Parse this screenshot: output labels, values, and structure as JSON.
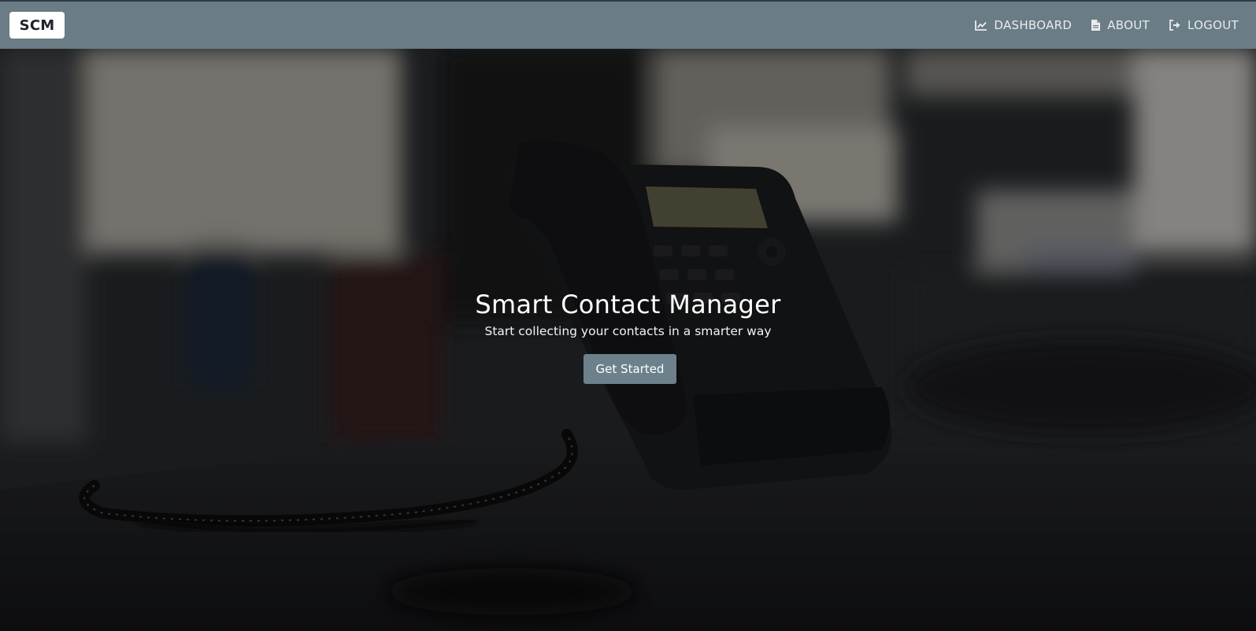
{
  "navbar": {
    "brand": "SCM",
    "links": [
      {
        "label": "DASHBOARD",
        "icon": "chart-line-icon"
      },
      {
        "label": "ABOUT",
        "icon": "document-icon"
      },
      {
        "label": "LOGOUT",
        "icon": "sign-out-icon"
      }
    ],
    "background": "#6a7c85"
  },
  "hero": {
    "title": "Smart Contact Manager",
    "subtitle": "Start collecting your contacts in a smarter way",
    "button_label": "Get Started",
    "button_color": "#6c818b",
    "background_image": "office-desk-phone-photo"
  }
}
